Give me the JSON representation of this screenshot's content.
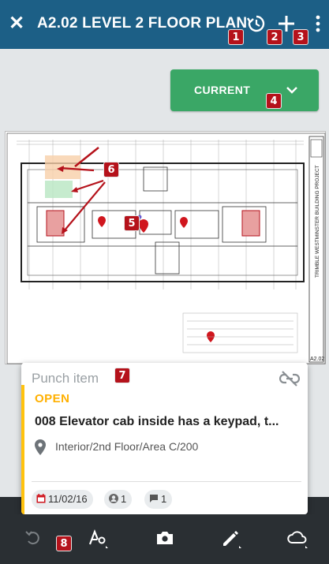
{
  "header": {
    "title": "A2.02 LEVEL 2 FLOOR PLAN",
    "close_icon": "close-icon",
    "history_icon": "history-icon",
    "add_icon": "plus-icon",
    "more_icon": "more-vertical-icon",
    "background": "#1c5f86"
  },
  "version_selector": {
    "label": "CURRENT",
    "icon": "chevron-down-icon",
    "color": "#3aa766"
  },
  "sheet": {
    "project_title": "TRIMBLE WESTMINSTER BUILDING PROJECT",
    "sheet_number": "A2.02"
  },
  "punch_card": {
    "type_label": "Punch item",
    "status": "OPEN",
    "subject": "008 Elevator cab inside has a keypad, t...",
    "location": "Interior/2nd Floor/Area C/200",
    "date": "11/02/16",
    "assignee_count": "1",
    "comment_count": "1",
    "status_color": "#ffb000",
    "accent_color": "#ffc20e"
  },
  "toolbar": {
    "items": [
      "undo-icon",
      "markup-tools-icon",
      "camera-icon",
      "pen-icon",
      "cloud-icon"
    ]
  },
  "callouts": [
    "1",
    "2",
    "3",
    "4",
    "5",
    "6",
    "7",
    "8"
  ]
}
